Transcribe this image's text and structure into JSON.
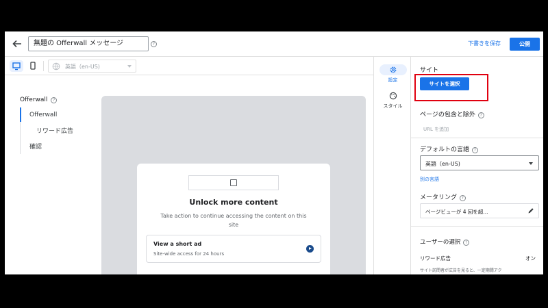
{
  "header": {
    "message_title": "無題の Offerwall メッセージ",
    "save_draft_label": "下書きを保存",
    "publish_label": "公開"
  },
  "toolbar": {
    "language_value": "英語（en-US)"
  },
  "nav": {
    "title": "Offerwall",
    "items": [
      {
        "label": "Offerwall"
      },
      {
        "label": "リワード広告"
      },
      {
        "label": "確認"
      }
    ]
  },
  "preview": {
    "title": "Unlock more content",
    "description": "Take action to continue accessing the content on this site",
    "option_title": "View a short ad",
    "option_subtitle": "Site-wide access for 24 hours"
  },
  "rail": {
    "settings_label": "設定",
    "style_label": "スタイル"
  },
  "panel": {
    "site_title": "サイト",
    "site_button_label": "サイトを選択",
    "page_include_title": "ページの包含と除外",
    "add_url_hint": "URL を追加",
    "default_language_title": "デフォルトの言語",
    "default_language_value": "英語（en-US)",
    "other_language_link": "別の言語",
    "metering_title": "メータリング",
    "metering_value": "ページビューが 4 回を超...",
    "user_choice_title": "ユーザーの選択",
    "rewarded_ads_label": "リワード広告",
    "rewarded_ads_value": "オン",
    "rewarded_ads_desc": "サイト訪問者が広告を見ると、一定期間アク"
  },
  "colors": {
    "accent": "#1a73e8",
    "highlight_box": "#e0000f"
  }
}
